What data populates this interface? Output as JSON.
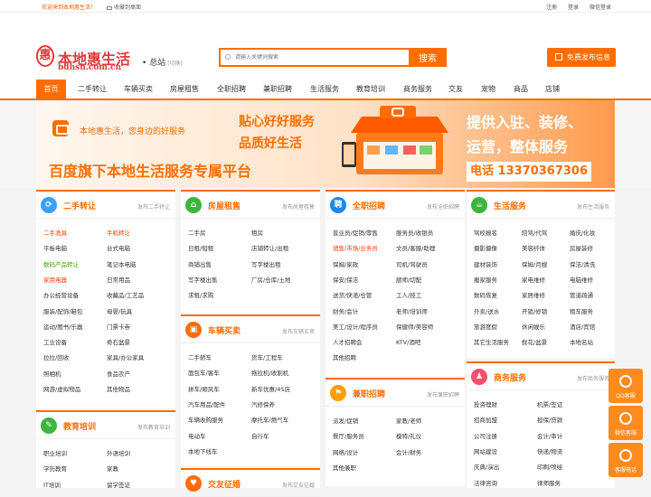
{
  "topbar": {
    "welcome": "欢迎来到本地惠生活！",
    "favorite": "收藏到桌面",
    "register": "注册",
    "login": "登录",
    "wechat": "微信登录"
  },
  "logo": {
    "mark": "惠",
    "name": "本地惠生活",
    "domain": "bdhsh.com.cn"
  },
  "city": {
    "name": "总站",
    "switch": "[切换]"
  },
  "search": {
    "placeholder": "请输入关键词搜索",
    "button": "搜索"
  },
  "post_button": "免费发布信息",
  "nav": [
    "首页",
    "二手转让",
    "车辆买卖",
    "房屋租售",
    "全职招聘",
    "兼职招聘",
    "生活服务",
    "教育培训",
    "商务服务",
    "交友",
    "宠物",
    "商品",
    "店铺"
  ],
  "banner": {
    "slogan": "本地惠生活，您身边的好服务",
    "title1": "贴心好好服务",
    "title2": "品质好生活",
    "main": "百度旗下本地生活服务专属平台",
    "right1": "提供入驻、装修、",
    "right2": "运营，整体服务",
    "phone": "电话 13370367306"
  },
  "cards": [
    {
      "id": "ershou",
      "title": "二手转让",
      "icon": "⟳",
      "pub": "发布二手转让",
      "items": [
        "二手渔具",
        "手机转让",
        "平板电脑",
        "台式电脑",
        "数码产品转让",
        "笔记本电脑",
        "家用电器",
        "日常用品",
        "办公经营设备",
        "收藏品/工艺品",
        "服装/配饰/鞋包",
        "母婴/玩具",
        "运动/图书/乐器",
        "门票卡券",
        "工业设备",
        "奇石盆景",
        "拉拉/回收",
        "家具/办公家具",
        "照相机",
        "食品农产",
        "网游/虚拟物品",
        "其他物品"
      ]
    },
    {
      "id": "fangwu",
      "title": "房屋租售",
      "icon": "⌂",
      "pub": "发布房屋租售",
      "items": [
        "二手房",
        "租房",
        "日租/短租",
        "店铺转让/出租",
        "商铺出售",
        "写字楼出租",
        "写字楼出售",
        "厂房/仓库/土地",
        "求租/求购"
      ]
    },
    {
      "id": "cheliang",
      "title": "车辆买卖",
      "icon": "▣",
      "pub": "发布车辆买卖",
      "items": [
        "二手轿车",
        "货车/工程车",
        "面包车/客车",
        "拖拉机/收割机",
        "拼车/顺风车",
        "新车优惠/4S店",
        "汽车用品/配件",
        "汽修保养",
        "车辆收购服务",
        "摩托车/燃气车",
        "电动车",
        "自行车",
        "本地下线车"
      ]
    },
    {
      "id": "quanzhi",
      "title": "全职招聘",
      "icon": "聘",
      "pub": "发布全职招聘",
      "items": [
        "普业员/促销/零售",
        "服务员/收银员",
        "销售/市场/业务员",
        "文员/客服/助理",
        "保姆/家政",
        "司机/驾驶员",
        "保安/保洁",
        "厨师/切配",
        "送货/快递/仓管",
        "工人/技工",
        "财务/会计",
        "老师/培训师",
        "美工/设计/程序员",
        "保健师/美容师",
        "人才招聘会",
        "KTV/酒吧",
        "其他招聘"
      ]
    },
    {
      "id": "jianzhi",
      "title": "兼职招聘",
      "icon": "⚑",
      "pub": "发布兼职招聘",
      "items": [
        "派发/促销",
        "家教/老师",
        "餐厅/服务员",
        "模特/礼仪",
        "网络/设计",
        "会计/财务",
        "其他兼职"
      ]
    },
    {
      "id": "shenghuo",
      "title": "生活服务",
      "icon": "☕",
      "pub": "发布生活服务",
      "items": [
        "驾校报名",
        "陪驾/代驾",
        "婚庆/化妆",
        "摄影摄像",
        "美容纤体",
        "房屋装修",
        "建材装饰",
        "保姆/月嫂",
        "保洁/清洗",
        "搬家服务",
        "家电维修",
        "电脑维修",
        "数码恢复",
        "家居维修",
        "管道疏通",
        "外卖/送水",
        "开锁/修锁",
        "租车服务",
        "旅游度假",
        "休闲娱乐",
        "酒店/宾馆",
        "其它生活服务",
        "鲜花/盆景",
        "本地名站"
      ]
    },
    {
      "id": "shangwu",
      "title": "商务服务",
      "icon": "♟",
      "pub": "发布商务服务",
      "items": [
        "投资理财",
        "机票/签证",
        "招商加盟",
        "担保/贷款",
        "公司注册",
        "会计/审计",
        "网站建设",
        "快递/物流",
        "庆典/演出",
        "印刷/喷绘",
        "法律咨询",
        "律师服务"
      ]
    },
    {
      "id": "jiaoyu",
      "title": "教育培训",
      "icon": "✎",
      "pub": "发布教育培训",
      "items": [
        "职业培训",
        "外语培训",
        "学历教育",
        "家教",
        "IT培训",
        "留学签证"
      ]
    },
    {
      "id": "jiaoyou",
      "title": "交友征婚",
      "icon": "♥",
      "pub": "发布交友征婚",
      "items": []
    }
  ],
  "floatbar": [
    "QQ客服",
    "微信客服",
    "客服电话"
  ],
  "colors": {
    "accent": "#ff6d00",
    "red": "#e4393c",
    "highlight": "#ff3c00",
    "green": "#3aa500"
  }
}
